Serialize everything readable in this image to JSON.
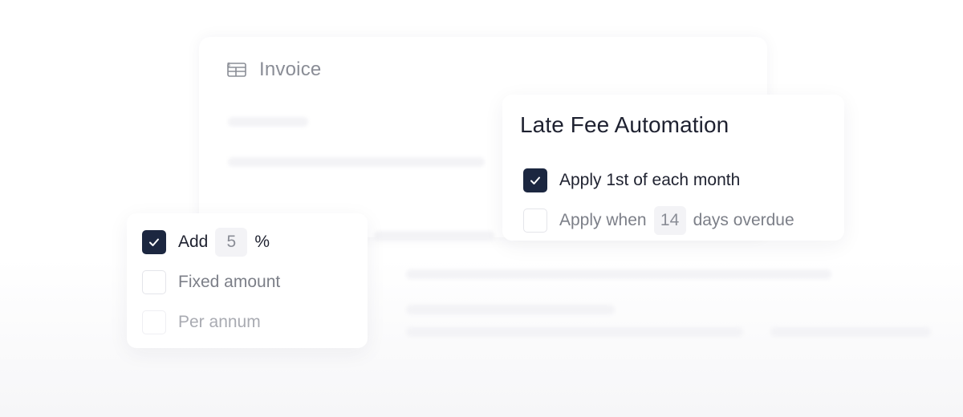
{
  "invoice": {
    "title": "Invoice",
    "icon": "invoice-icon"
  },
  "late_fee_automation": {
    "title": "Late Fee Automation",
    "options": [
      {
        "label": "Apply 1st of each month",
        "checked": true
      },
      {
        "label_before": "Apply when",
        "days": "14",
        "label_after": "days overdue",
        "checked": false
      }
    ]
  },
  "fee_options": {
    "items": [
      {
        "label_before": "Add",
        "value": "5",
        "label_after": "%",
        "checked": true
      },
      {
        "label": "Fixed amount",
        "checked": false
      },
      {
        "label": "Per annum",
        "checked": false
      }
    ]
  },
  "colors": {
    "checkbox_checked": "#1c2740",
    "muted_text": "#8a8d96"
  }
}
